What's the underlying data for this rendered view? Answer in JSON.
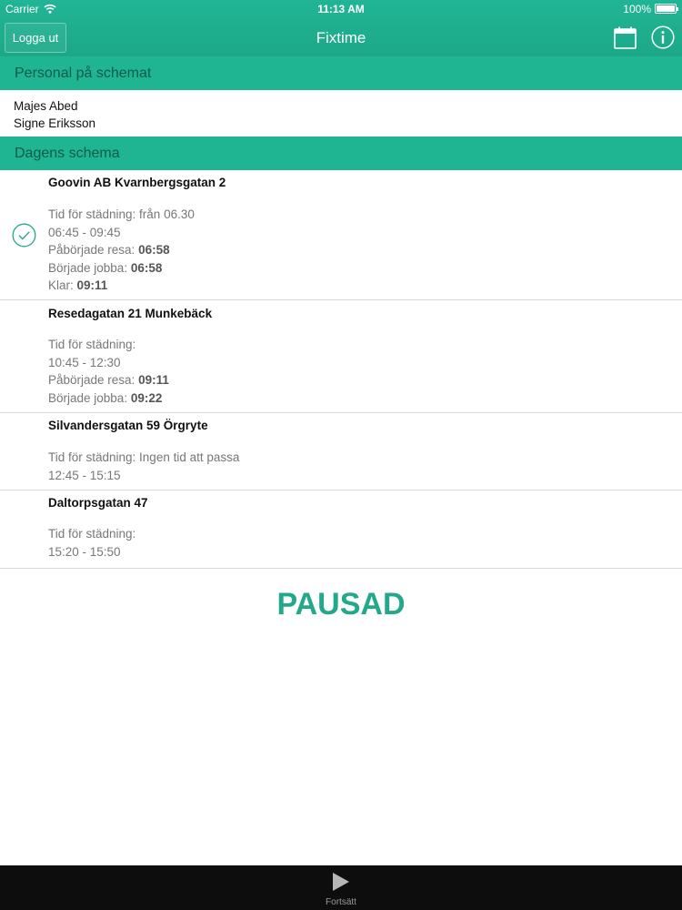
{
  "status_bar": {
    "carrier": "Carrier",
    "time": "11:13 AM",
    "battery": "100%"
  },
  "nav": {
    "logout_label": "Logga ut",
    "title": "Fixtime"
  },
  "icons": {
    "calendar": "calendar-icon",
    "info": "info-icon",
    "check": "check-icon",
    "play": "play-icon"
  },
  "colors": {
    "accent": "#21b595",
    "paused": "#21a98a",
    "toolbar": "#0d0d0d"
  },
  "staff_section": {
    "header": "Personal på schemat",
    "names": [
      "Majes Abed",
      "Signe Eriksson"
    ]
  },
  "schedule_section": {
    "header": "Dagens schema",
    "jobs": [
      {
        "title": "Goovin AB Kvarnbergsgatan 2",
        "cleaning_time": "Tid för städning: från 06.30",
        "time_range": "06:45 - 09:45",
        "travel_label": "Påbörjade resa:",
        "travel_value": "06:58",
        "work_label": "Började jobba:",
        "work_value": "06:58",
        "done_label": "Klar:",
        "done_value": "09:11",
        "completed": true
      },
      {
        "title": "Resedagatan 21 Munkebäck",
        "cleaning_time": "Tid för städning:",
        "time_range": "10:45 - 12:30",
        "travel_label": "Påbörjade resa:",
        "travel_value": "09:11",
        "work_label": "Började jobba:",
        "work_value": "09:22",
        "completed": false
      },
      {
        "title": "Silvandersgatan 59 Örgryte",
        "cleaning_time": "Tid för städning: Ingen tid att passa",
        "time_range": "12:45 - 15:15",
        "completed": false
      },
      {
        "title": "Daltorpsgatan 47",
        "cleaning_time": "Tid för städning:",
        "time_range": "15:20 - 15:50",
        "completed": false
      }
    ]
  },
  "paused_label": "PAUSAD",
  "toolbar": {
    "continue_label": "Fortsätt"
  }
}
